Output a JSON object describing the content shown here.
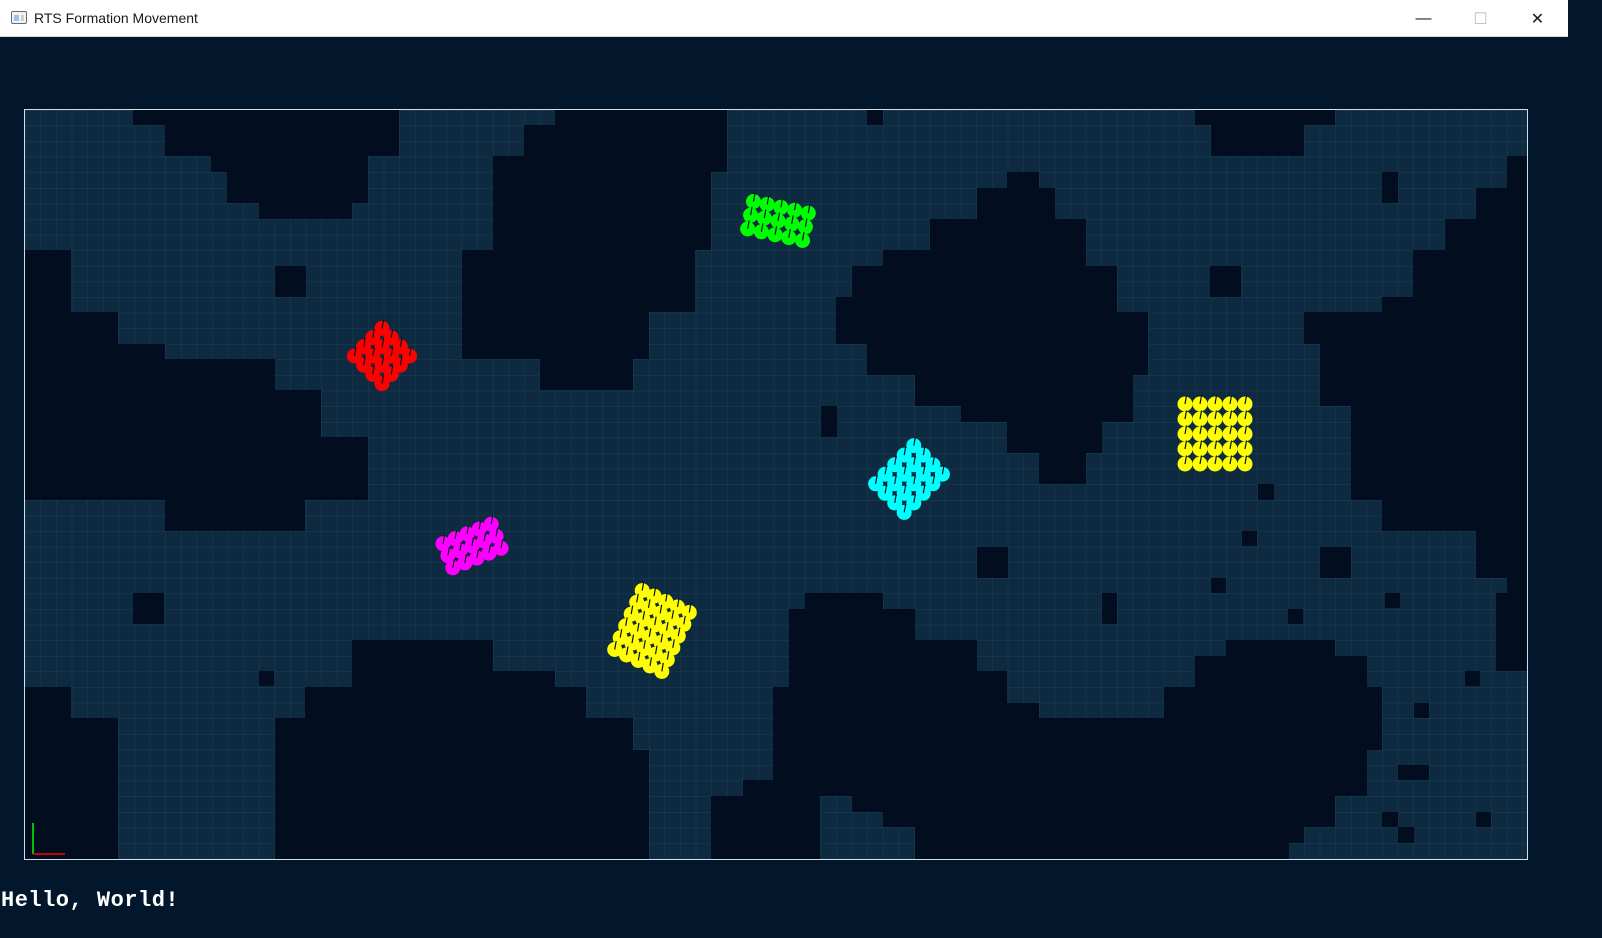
{
  "window": {
    "title": "RTS Formation Movement",
    "minimize_glyph": "—",
    "maximize_glyph": "☐",
    "close_glyph": "✕"
  },
  "viewport": {
    "floor_color": "#0d2a40",
    "grid_line_color": "#1f4762",
    "obstacle_color": "#020d1f"
  },
  "formations": [
    {
      "color": "#ff0000",
      "units": 16
    },
    {
      "color": "#00ff00",
      "units": 15
    },
    {
      "color": "#ff00ff",
      "units": 15
    },
    {
      "color": "#ffff00",
      "units": 30
    },
    {
      "color": "#00ffff",
      "units": 20
    },
    {
      "color": "#ffff00",
      "units": 25
    }
  ],
  "axis_gizmo": {
    "x_color": "#ff0000",
    "y_color": "#00ff00"
  },
  "status_text": "Hello, World!"
}
